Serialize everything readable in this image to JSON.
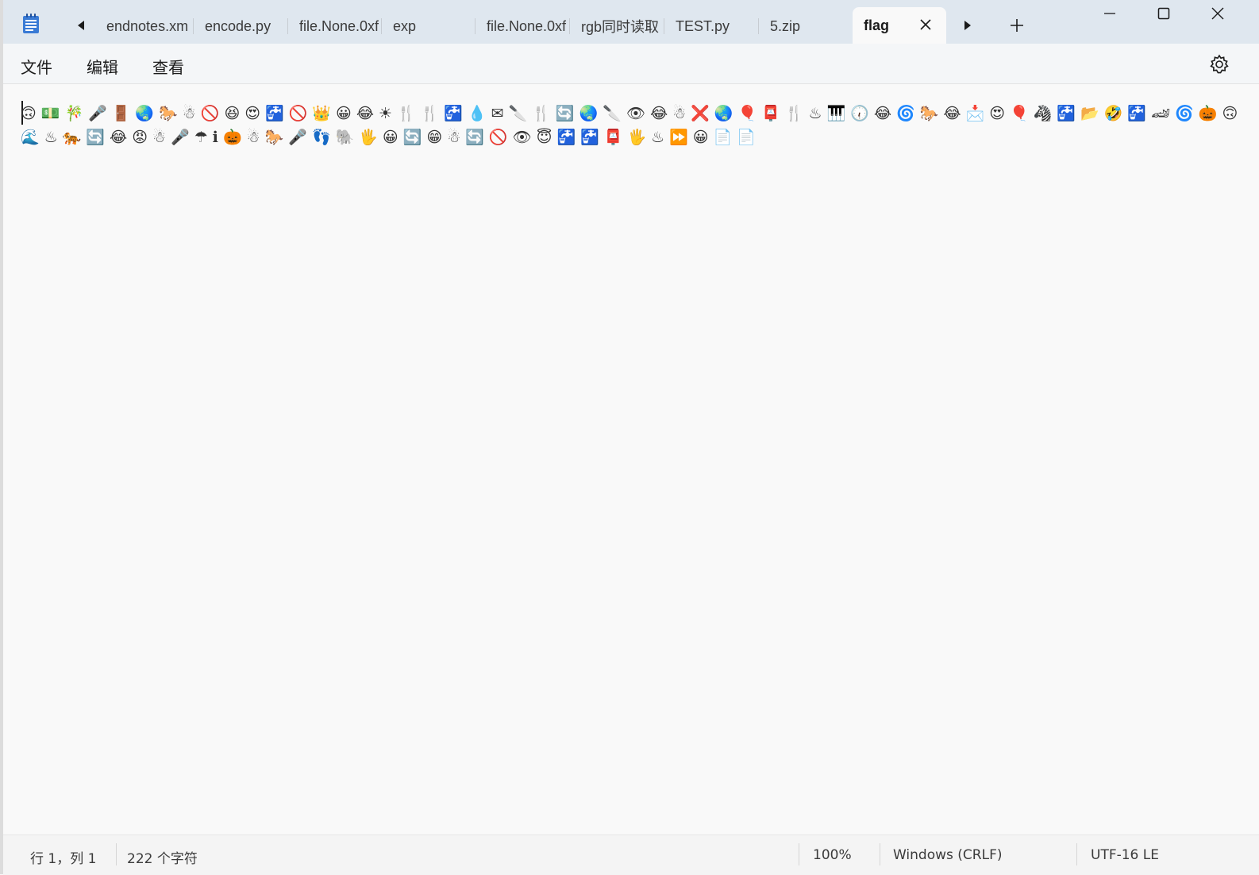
{
  "tabs": [
    {
      "label": "endnotes.xm",
      "active": false
    },
    {
      "label": "encode.py",
      "active": false
    },
    {
      "label": "file.None.0xf",
      "active": false
    },
    {
      "label": "exp",
      "active": false
    },
    {
      "label": "file.None.0xf",
      "active": false
    },
    {
      "label": "rgb同时读取",
      "active": false
    },
    {
      "label": "TEST.py",
      "active": false
    },
    {
      "label": "5.zip",
      "active": false
    },
    {
      "label": "flag",
      "active": true
    }
  ],
  "menu": {
    "file": "文件",
    "edit": "编辑",
    "view": "查看"
  },
  "editor": {
    "content": "🙃💵🎋🎤🚪🌏🐎☃🚫😆😍🚰🚫👑😀😂☀🍴🍴🚰💧✉🔪🍴🔄🌏🔪👁😂☃❌🌏🎈📮🍴♨🎹🕡😂🌀🐎😂📩😍🎈🦓🚰📂🤣🚰🏎🌀🎃🙃🌊♨🐅🔄😂😡☃🎤☂ℹ🎃☃🐎🎤👣🐘🖐😀🔄😁☃🔄🚫👁😇🚰🚰📮🖐♨⏩😀📄📄"
  },
  "status": {
    "position": "行 1，列 1",
    "char_count": "222 个字符",
    "zoom": "100%",
    "line_ending": "Windows (CRLF)",
    "encoding": "UTF-16 LE"
  },
  "icons": {
    "app": "notepad-icon",
    "prev": "caret-left-icon",
    "next": "caret-right-icon",
    "new_tab": "plus-icon",
    "close_tab": "close-icon",
    "minimize": "minimize-icon",
    "maximize": "maximize-icon",
    "close_window": "close-icon",
    "settings": "gear-icon"
  },
  "colors": {
    "titlebar": "#dfe7ef",
    "editor_bg": "#f9f9f9",
    "app_icon": "#3a7bd5"
  }
}
